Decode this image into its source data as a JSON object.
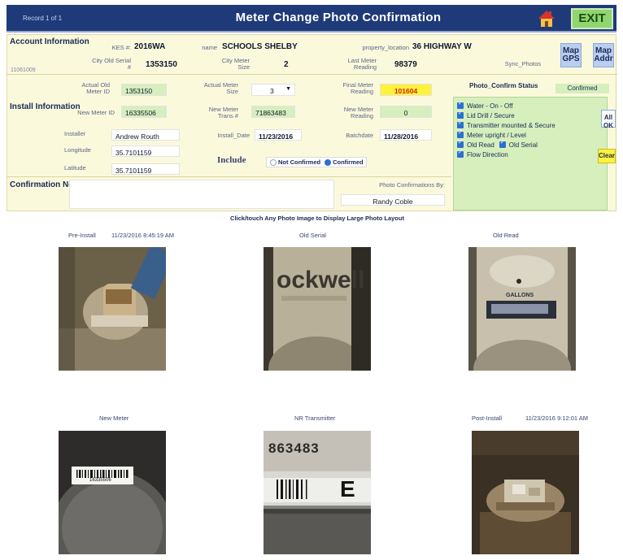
{
  "header": {
    "record_text": "Record  1  of  1",
    "title": "Meter Change Photo Confirmation",
    "home_icon": "home-icon",
    "exit_label": "EXIT",
    "colors": {
      "header_bg": "#1e3a78",
      "exit_bg": "#8fd66e"
    }
  },
  "account": {
    "section_label": "Account Information",
    "account_id": "11061009",
    "kes_label": "KES #:",
    "kes_value": "2016WA",
    "name_label": "name",
    "name_value": "SCHOOLS SHELBY",
    "property_label": "property_location",
    "property_value": "36 HIGHWAY W",
    "city_old_serial_label": "City Old Serial #",
    "city_old_serial_value": "1353150",
    "city_meter_size_label": "City Meter Size",
    "city_meter_size_value": "2",
    "last_meter_reading_label": "Last Meter Reading",
    "last_meter_reading_value": "98379",
    "sync_photos_label": "Sync_Photos",
    "map_gps_label": "Map GPS",
    "map_addr_label": "Map Addr"
  },
  "install": {
    "section_label": "Install Information",
    "actual_old_meter_id_label": "Actual Old Meter ID",
    "actual_old_meter_id_value": "1353150",
    "new_meter_id_label": "New Meter ID",
    "new_meter_id_value": "16335506",
    "installer_label": "Installer",
    "installer_value": "Andrew Routh",
    "longitude_label": "Longitude",
    "longitude_value": "35.7101159",
    "latitude_label": "Latitude",
    "latitude_value": "35.7101159",
    "actual_meter_size_label": "Actual Meter Size",
    "actual_meter_size_value": "3",
    "new_meter_trans_label": "New Meter Trans #",
    "new_meter_trans_value": "71863483",
    "install_date_label": "Install_Date",
    "install_date_value": "11/23/2016",
    "include_label": "Include",
    "radio_not_confirmed": "Not Confirmed",
    "radio_confirmed": "Confirmed",
    "final_meter_reading_label": "Final Meter Reading",
    "final_meter_reading_value": "101604",
    "new_meter_reading_label": "New Meter Reading",
    "new_meter_reading_value": "0",
    "batch_date_label": "Batchdate",
    "batch_date_value": "11/28/2016",
    "photo_confirm_status_label": "Photo_Confirm Status",
    "photo_confirm_status_value": "Confirmed",
    "checklist": [
      "Water - On - Off",
      "Lid Drill / Secure",
      "Transmitter mounted & Secure",
      "Meter upright / Level",
      "Old Read",
      "Old Serial",
      "Flow Direction"
    ],
    "all_ok_label": "All OK",
    "clear_label": "Clear"
  },
  "notes": {
    "section_label": "Confirmation Notes",
    "photo_confirmations_by_label": "Photo Confirmations By:",
    "photo_confirmations_by_value": "Randy Coble"
  },
  "photos": {
    "hint": "Click/touch Any Photo Image to Display Large Photo Layout",
    "items": [
      {
        "label": "Pre-Install",
        "timestamp": "11/23/2016 8:45:19 AM"
      },
      {
        "label": "Old Serial",
        "timestamp": ""
      },
      {
        "label": "Old Read",
        "timestamp": ""
      },
      {
        "label": "New Meter",
        "timestamp": ""
      },
      {
        "label": "NR Transmitter",
        "timestamp": ""
      },
      {
        "label": "Post-Install",
        "timestamp": "11/23/2016 9:12:01 AM"
      }
    ],
    "overlay_texts": {
      "old_serial_brand": "ockwell",
      "old_read_unit": "GALLONS",
      "new_meter_barcode": "16335506",
      "transmitter_number": "863483",
      "transmitter_letter": "E"
    }
  }
}
